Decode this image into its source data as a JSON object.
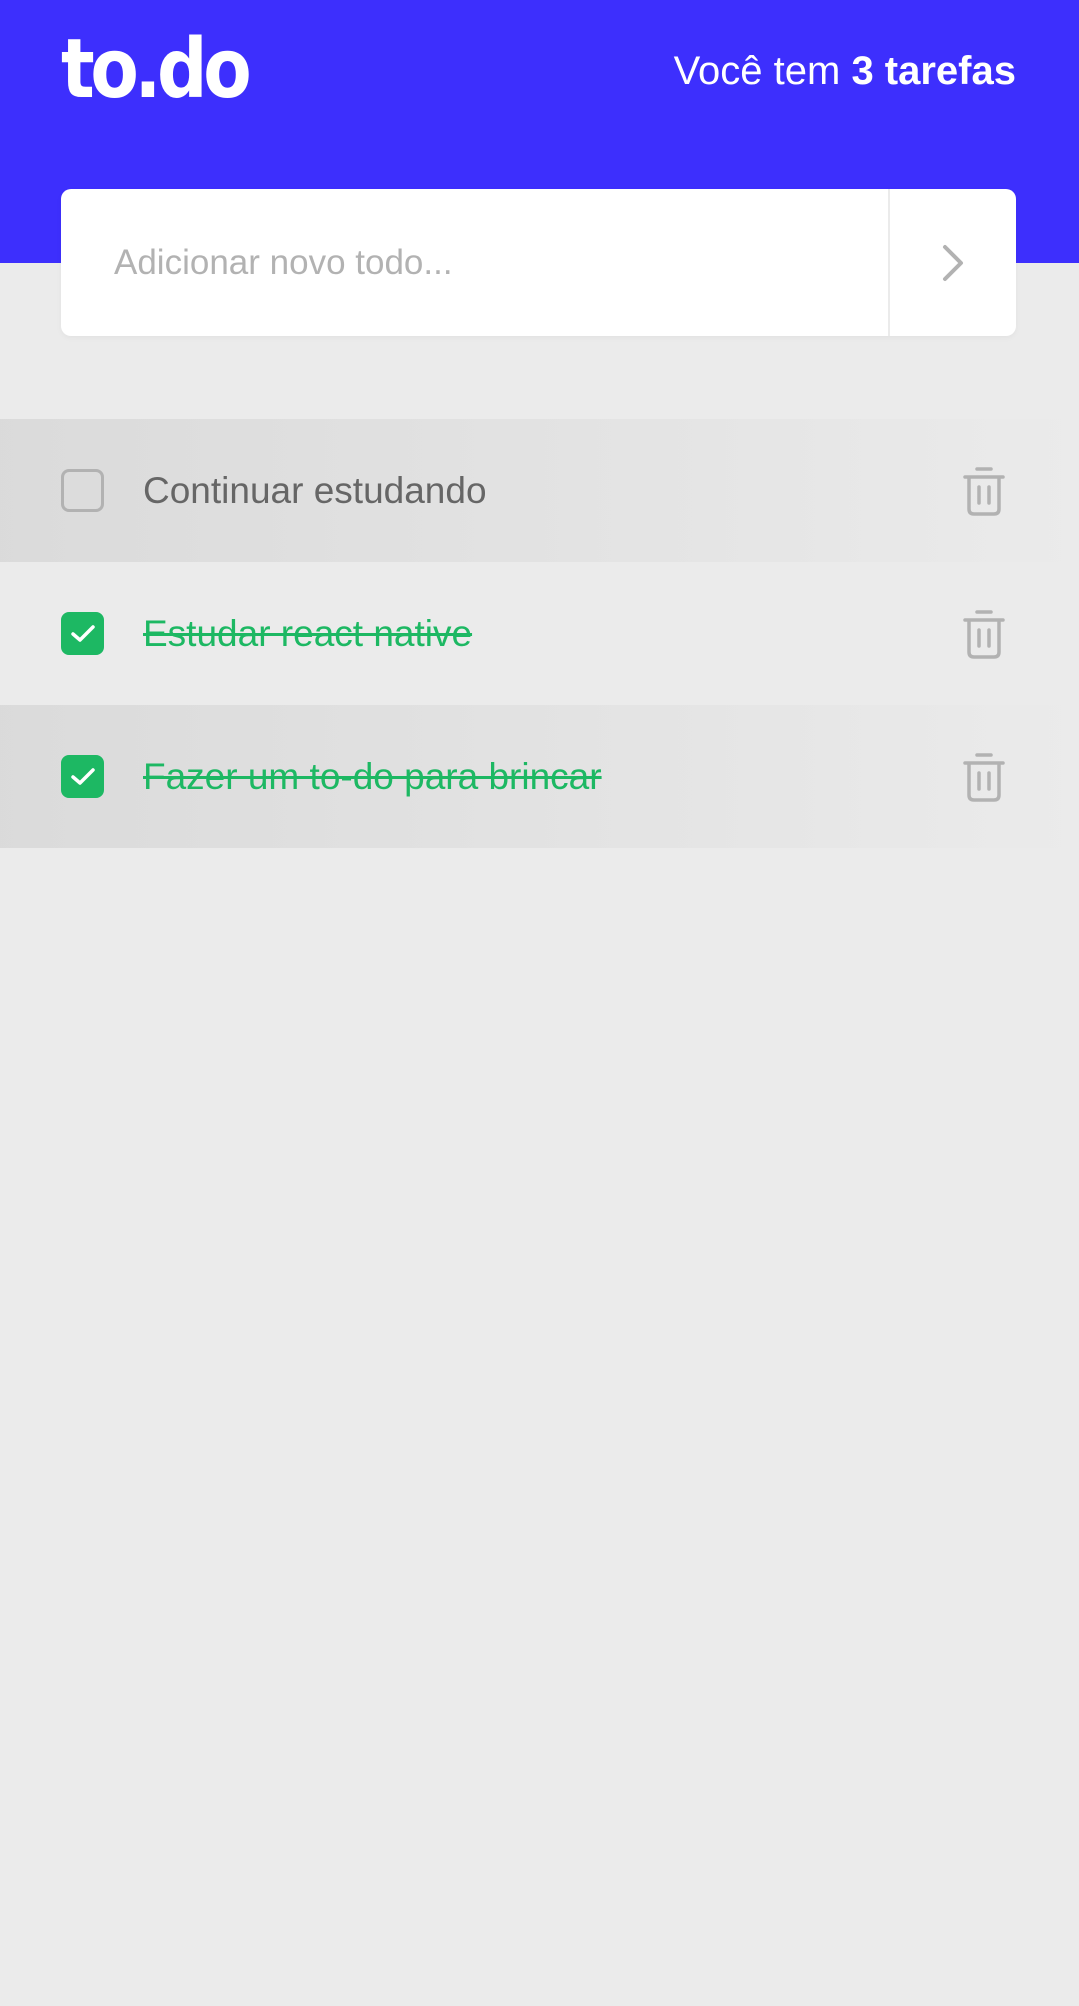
{
  "header": {
    "logo_text": "to.do",
    "count_prefix": "Você tem ",
    "count_emphasis": "3 tarefas"
  },
  "new_todo": {
    "placeholder": "Adicionar novo todo...",
    "value": "",
    "submit_icon": "chevron-right-icon"
  },
  "tasks": [
    {
      "title": "Continuar estudando",
      "done": false
    },
    {
      "title": "Estudar react native",
      "done": true
    },
    {
      "title": "Fazer um to-do para brincar",
      "done": true
    }
  ],
  "icons": {
    "check": "check-icon",
    "delete": "trash-icon"
  },
  "colors": {
    "header_bg": "#3d2ffd",
    "page_bg": "#ebebeb",
    "done": "#1db863",
    "pending_text": "#666666",
    "muted": "#b2b2b2"
  }
}
